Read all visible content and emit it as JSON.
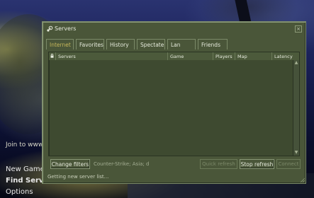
{
  "menu": {
    "join_text": "Join to www",
    "new_game": "New Game",
    "find_servers": "Find Server",
    "options": "Options"
  },
  "window": {
    "title": "Servers",
    "close": "×"
  },
  "tabs": [
    {
      "label": "Internet",
      "active": true
    },
    {
      "label": "Favorites",
      "active": false
    },
    {
      "label": "History",
      "active": false
    },
    {
      "label": "Spectate",
      "active": false
    },
    {
      "label": "Lan",
      "active": false
    },
    {
      "label": "Friends",
      "active": false
    }
  ],
  "list": {
    "columns": [
      "Servers",
      "Game",
      "Players",
      "Map",
      "Latency"
    ],
    "rows": []
  },
  "controls": {
    "change_filters": "Change filters",
    "filter_summary": "Counter-Strike; Asia; d",
    "quick_refresh": "Quick refresh",
    "stop_refresh": "Stop refresh",
    "connect": "Connect"
  },
  "status": "Getting new server list...",
  "colors": {
    "window_bg": "#4a5639",
    "active_tab_text": "#c5b65a",
    "text": "#e6eadc"
  },
  "icons": [
    "steam-icon",
    "lock-icon",
    "scroll-up-icon",
    "scroll-down-icon",
    "resize-grip-icon"
  ]
}
